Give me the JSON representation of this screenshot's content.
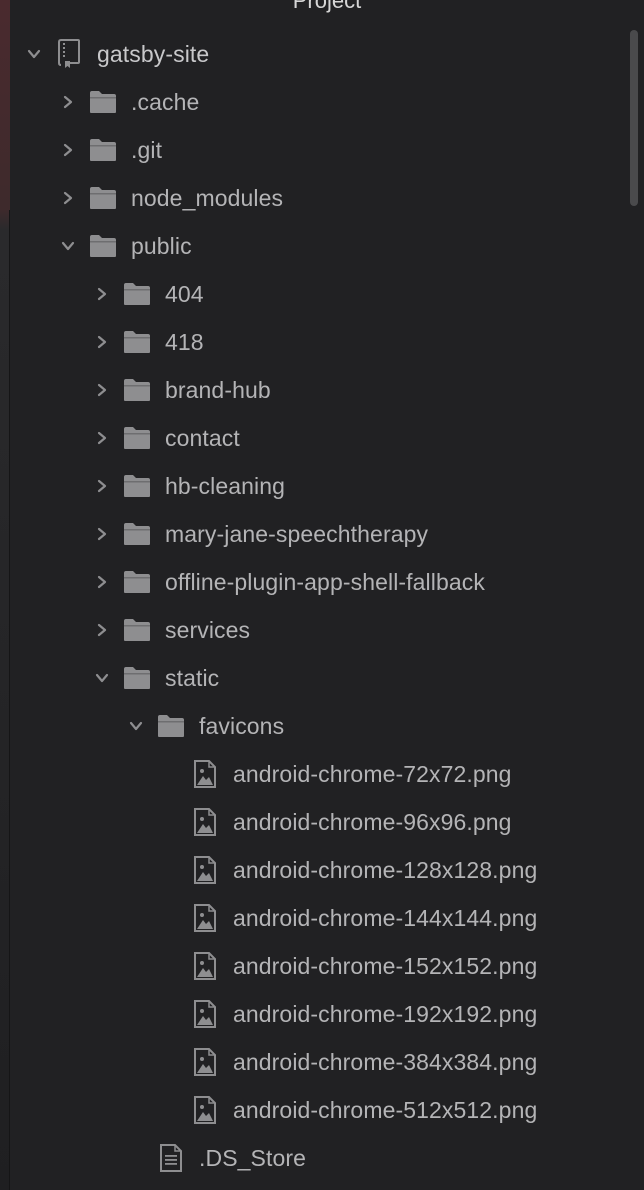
{
  "panel": {
    "title": "Project"
  },
  "tree": [
    {
      "label": "gatsby-site",
      "icon": "repo-icon",
      "depth": 0,
      "expanded": true,
      "kind": "repo"
    },
    {
      "label": ".cache",
      "icon": "folder-icon",
      "depth": 1,
      "expanded": false,
      "kind": "folder"
    },
    {
      "label": ".git",
      "icon": "folder-icon",
      "depth": 1,
      "expanded": false,
      "kind": "folder"
    },
    {
      "label": "node_modules",
      "icon": "folder-icon",
      "depth": 1,
      "expanded": false,
      "kind": "folder"
    },
    {
      "label": "public",
      "icon": "folder-icon",
      "depth": 1,
      "expanded": true,
      "kind": "folder"
    },
    {
      "label": "404",
      "icon": "folder-icon",
      "depth": 2,
      "expanded": false,
      "kind": "folder"
    },
    {
      "label": "418",
      "icon": "folder-icon",
      "depth": 2,
      "expanded": false,
      "kind": "folder"
    },
    {
      "label": "brand-hub",
      "icon": "folder-icon",
      "depth": 2,
      "expanded": false,
      "kind": "folder"
    },
    {
      "label": "contact",
      "icon": "folder-icon",
      "depth": 2,
      "expanded": false,
      "kind": "folder"
    },
    {
      "label": "hb-cleaning",
      "icon": "folder-icon",
      "depth": 2,
      "expanded": false,
      "kind": "folder"
    },
    {
      "label": "mary-jane-speechtherapy",
      "icon": "folder-icon",
      "depth": 2,
      "expanded": false,
      "kind": "folder"
    },
    {
      "label": "offline-plugin-app-shell-fallback",
      "icon": "folder-icon",
      "depth": 2,
      "expanded": false,
      "kind": "folder"
    },
    {
      "label": "services",
      "icon": "folder-icon",
      "depth": 2,
      "expanded": false,
      "kind": "folder"
    },
    {
      "label": "static",
      "icon": "folder-icon",
      "depth": 2,
      "expanded": true,
      "kind": "folder"
    },
    {
      "label": "favicons",
      "icon": "folder-icon",
      "depth": 3,
      "expanded": true,
      "kind": "folder"
    },
    {
      "label": "android-chrome-72x72.png",
      "icon": "image-file-icon",
      "depth": 4,
      "kind": "image"
    },
    {
      "label": "android-chrome-96x96.png",
      "icon": "image-file-icon",
      "depth": 4,
      "kind": "image"
    },
    {
      "label": "android-chrome-128x128.png",
      "icon": "image-file-icon",
      "depth": 4,
      "kind": "image"
    },
    {
      "label": "android-chrome-144x144.png",
      "icon": "image-file-icon",
      "depth": 4,
      "kind": "image"
    },
    {
      "label": "android-chrome-152x152.png",
      "icon": "image-file-icon",
      "depth": 4,
      "kind": "image"
    },
    {
      "label": "android-chrome-192x192.png",
      "icon": "image-file-icon",
      "depth": 4,
      "kind": "image"
    },
    {
      "label": "android-chrome-384x384.png",
      "icon": "image-file-icon",
      "depth": 4,
      "kind": "image"
    },
    {
      "label": "android-chrome-512x512.png",
      "icon": "image-file-icon",
      "depth": 4,
      "kind": "image"
    },
    {
      "label": ".DS_Store",
      "icon": "text-file-icon",
      "depth": 3,
      "kind": "file"
    }
  ],
  "colors": {
    "background": "#212123",
    "text": "#b4b4b6",
    "icon": "#8e8e90"
  }
}
